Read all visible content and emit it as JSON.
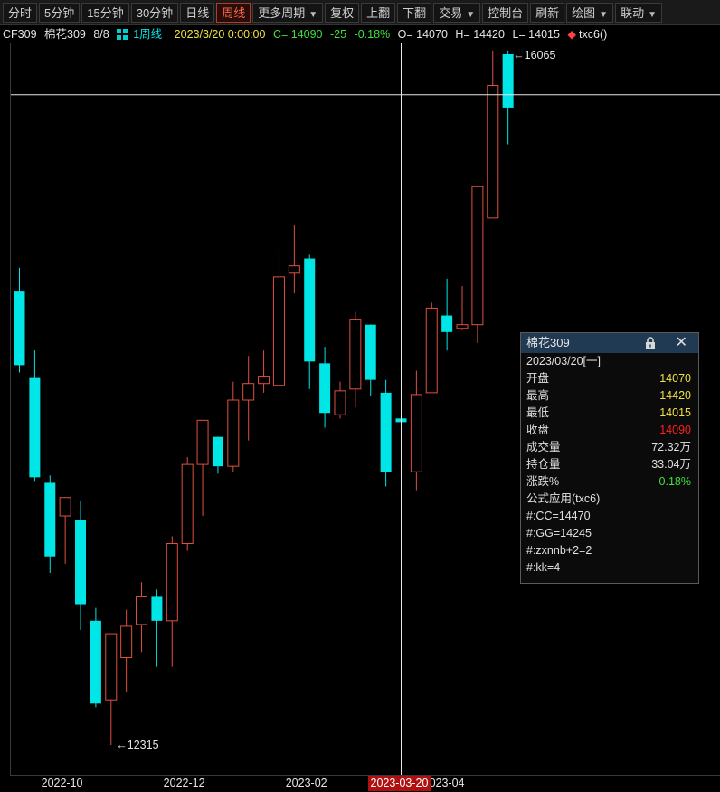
{
  "toolbar": {
    "buttons": [
      {
        "label": "分时",
        "active": false,
        "dropdown": false
      },
      {
        "label": "5分钟",
        "active": false,
        "dropdown": false
      },
      {
        "label": "15分钟",
        "active": false,
        "dropdown": false
      },
      {
        "label": "30分钟",
        "active": false,
        "dropdown": false
      },
      {
        "label": "日线",
        "active": false,
        "dropdown": false
      },
      {
        "label": "周线",
        "active": true,
        "dropdown": false
      },
      {
        "label": "更多周期",
        "active": false,
        "dropdown": true
      },
      {
        "label": "复权",
        "active": false,
        "dropdown": false
      },
      {
        "label": "上翻",
        "active": false,
        "dropdown": false
      },
      {
        "label": "下翻",
        "active": false,
        "dropdown": false
      },
      {
        "label": "交易",
        "active": false,
        "dropdown": true
      },
      {
        "label": "控制台",
        "active": false,
        "dropdown": false
      },
      {
        "label": "刷新",
        "active": false,
        "dropdown": false
      },
      {
        "label": "绘图",
        "active": false,
        "dropdown": true
      },
      {
        "label": "联动",
        "active": false,
        "dropdown": true
      }
    ]
  },
  "infobar": {
    "code": "CF309",
    "name": "棉花309",
    "page": "8/8",
    "period": "1周线",
    "datetime": "2023/3/20 0:00:00",
    "close": "C= 14090",
    "change": "-25",
    "change_pct": "-0.18%",
    "open": "O= 14070",
    "high": "H= 14420",
    "low": "L= 14015",
    "indicator_icon": "diamond-icon",
    "indicator": "txc6()"
  },
  "popup": {
    "title": "棉花309",
    "date": "2023/03/20[一]",
    "rows": [
      {
        "label": "开盘",
        "value": "14070",
        "color": "#f0e040"
      },
      {
        "label": "最高",
        "value": "14420",
        "color": "#f0e040"
      },
      {
        "label": "最低",
        "value": "14015",
        "color": "#f0e040"
      },
      {
        "label": "收盘",
        "value": "14090",
        "color": "#ff2020"
      },
      {
        "label": "成交量",
        "value": "72.32万",
        "color": "#e0e0e0"
      },
      {
        "label": "持仓量",
        "value": "33.04万",
        "color": "#e0e0e0"
      },
      {
        "label": "涨跌%",
        "value": "-0.18%",
        "color": "#3fe03f"
      }
    ],
    "formula_title": "公式应用(txc6)",
    "formula_lines": [
      "#:CC=14470",
      "#:GG=14245",
      "#:zxnnb+2=2",
      "#:kk=4"
    ]
  },
  "chart_data": {
    "type": "candlestick",
    "series_name": "CF309",
    "up_color": "#e05040",
    "down_color": "#00e5e5",
    "ylim": [
      12100,
      16250
    ],
    "candles": [
      {
        "o": 14780,
        "h": 14910,
        "l": 14340,
        "c": 14380
      },
      {
        "o": 14310,
        "h": 14460,
        "l": 13750,
        "c": 13770
      },
      {
        "o": 13740,
        "h": 13780,
        "l": 13250,
        "c": 13340
      },
      {
        "o": 13560,
        "h": 13660,
        "l": 13300,
        "c": 13660
      },
      {
        "o": 13540,
        "h": 13640,
        "l": 12940,
        "c": 13080
      },
      {
        "o": 12990,
        "h": 13060,
        "l": 12520,
        "c": 12540
      },
      {
        "o": 12560,
        "h": 12700,
        "l": 12315,
        "c": 12920
      },
      {
        "o": 12790,
        "h": 13050,
        "l": 12600,
        "c": 12960
      },
      {
        "o": 12970,
        "h": 13200,
        "l": 12820,
        "c": 13120
      },
      {
        "o": 13120,
        "h": 13160,
        "l": 12740,
        "c": 12990
      },
      {
        "o": 12990,
        "h": 13450,
        "l": 12740,
        "c": 13410
      },
      {
        "o": 13410,
        "h": 13880,
        "l": 13370,
        "c": 13840
      },
      {
        "o": 13840,
        "h": 14080,
        "l": 13560,
        "c": 14080
      },
      {
        "o": 13990,
        "h": 13990,
        "l": 13790,
        "c": 13830
      },
      {
        "o": 13830,
        "h": 14290,
        "l": 13800,
        "c": 14190
      },
      {
        "o": 14190,
        "h": 14430,
        "l": 13970,
        "c": 14280
      },
      {
        "o": 14280,
        "h": 14460,
        "l": 14230,
        "c": 14320
      },
      {
        "o": 14270,
        "h": 15010,
        "l": 14260,
        "c": 14860
      },
      {
        "o": 14880,
        "h": 15140,
        "l": 14770,
        "c": 14920
      },
      {
        "o": 14960,
        "h": 14980,
        "l": 14250,
        "c": 14400
      },
      {
        "o": 14390,
        "h": 14480,
        "l": 14040,
        "c": 14120
      },
      {
        "o": 14110,
        "h": 14290,
        "l": 14090,
        "c": 14240
      },
      {
        "o": 14250,
        "h": 14670,
        "l": 14150,
        "c": 14630
      },
      {
        "o": 14600,
        "h": 14600,
        "l": 14210,
        "c": 14300
      },
      {
        "o": 14230,
        "h": 14300,
        "l": 13720,
        "c": 13800
      },
      {
        "o": 14090,
        "h": 14420,
        "l": 14015,
        "c": 14070
      },
      {
        "o": 13800,
        "h": 14350,
        "l": 13700,
        "c": 14220
      },
      {
        "o": 14230,
        "h": 14720,
        "l": 14230,
        "c": 14690
      },
      {
        "o": 14650,
        "h": 14850,
        "l": 14460,
        "c": 14560
      },
      {
        "o": 14580,
        "h": 14810,
        "l": 14570,
        "c": 14600
      },
      {
        "o": 14600,
        "h": 15350,
        "l": 14500,
        "c": 15350
      },
      {
        "o": 15180,
        "h": 16090,
        "l": 15180,
        "c": 15900
      },
      {
        "o": 16070,
        "h": 16090,
        "l": 15580,
        "c": 15780
      }
    ],
    "max_label": "16065",
    "min_label": "12315",
    "x_labels": [
      {
        "text": "2022-10",
        "index": 3
      },
      {
        "text": "2022-12",
        "index": 11
      },
      {
        "text": "2023-02",
        "index": 19
      },
      {
        "text": "2023-04",
        "index": 28
      }
    ],
    "cursor": {
      "index": 25,
      "price": 15850,
      "x_label": "2023-03-20"
    }
  }
}
